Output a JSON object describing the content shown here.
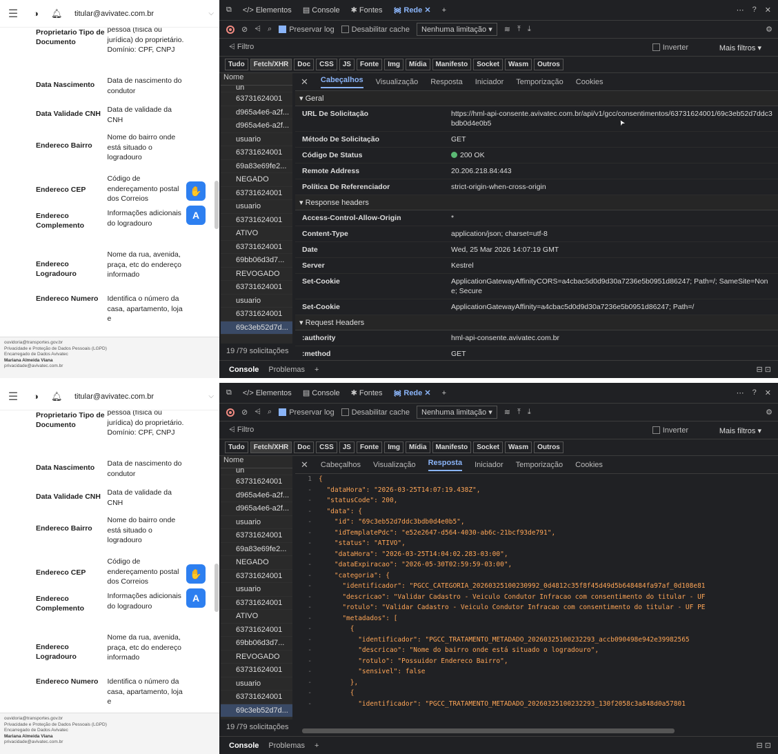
{
  "app": {
    "user_email": "titular@avivatec.com.br",
    "fab_label": "A"
  },
  "rows": [
    {
      "name": "Proprietario Tipo de Documento",
      "desc": "pessoa (física ou jurídica) do proprietário. Domínio: CPF, CNPJ"
    },
    {
      "name": "Data Nascimento",
      "desc": "Data de nascimento do condutor"
    },
    {
      "name": "Data Validade CNH",
      "desc": "Data de validade da CNH"
    },
    {
      "name": "Endereco Bairro",
      "desc": "Nome do bairro onde está situado o logradouro"
    },
    {
      "name": "Endereco CEP",
      "desc": "Código de endereçamento postal dos Correios"
    },
    {
      "name": "Endereco Complemento",
      "desc": "Informações adicionais do logradouro"
    },
    {
      "name": "Endereco Logradouro",
      "desc": "Nome da rua, avenida, praça, etc do endereço informado"
    },
    {
      "name": "Endereco Numero",
      "desc": "Identifica o número da casa, apartamento, loja e"
    }
  ],
  "footer": {
    "line1": "ouvidoria@transportes.gov.br",
    "line2": "Privacidade e Proteção de Dados Pessoais (LGPD)",
    "line3": "Encarregado de Dados Avivatec",
    "line4": "Mariana Almeida Viana",
    "line5": "privacidade@avivatec.com.br"
  },
  "devtools": {
    "tabs": [
      "Elementos",
      "Console",
      "Fontes",
      "Rede"
    ],
    "active_tab": "Rede",
    "preserve_log": "Preservar log",
    "disable_cache": "Desabilitar cache",
    "throttle": "Nenhuma limitação",
    "filter_placeholder": "Filtro",
    "invert": "Inverter",
    "more_filters": "Mais filtros",
    "chips": [
      "Tudo",
      "Fetch/XHR",
      "Doc",
      "CSS",
      "JS",
      "Fonte",
      "Img",
      "Mídia",
      "Manifesto",
      "Socket",
      "Wasm",
      "Outros"
    ],
    "chip_active": "Fetch/XHR",
    "name_header": "Nome",
    "names": [
      "un",
      "63731624001",
      "d965a4e6-a2f...",
      "d965a4e6-a2f...",
      "usuario",
      "63731624001",
      "69a83e69fe2...",
      "NEGADO",
      "63731624001",
      "usuario",
      "63731624001",
      "ATIVO",
      "63731624001",
      "69bb06d3d7...",
      "REVOGADO",
      "63731624001",
      "usuario",
      "63731624001",
      "69c3eb52d7d..."
    ],
    "count": "19 /79 solicitações",
    "panel_tabs": [
      "Cabeçalhos",
      "Visualização",
      "Resposta",
      "Iniciador",
      "Temporização",
      "Cookies"
    ],
    "drawer": [
      "Console",
      "Problemas"
    ],
    "json_toggle": "{ }"
  },
  "headers": {
    "general_title": "Geral",
    "general": [
      {
        "k": "URL De Solicitação",
        "v": "https://hml-api-consente.avivatec.com.br/api/v1/gcc/consentimentos/63731624001/69c3eb52d7ddc3bdb0d4e0b5"
      },
      {
        "k": "Método De Solicitação",
        "v": "GET"
      },
      {
        "k": "Código De Status",
        "v": "200 OK"
      },
      {
        "k": "Remote Address",
        "v": "20.206.218.84:443"
      },
      {
        "k": "Política De Referenciador",
        "v": "strict-origin-when-cross-origin"
      }
    ],
    "response_title": "Response headers",
    "response": [
      {
        "k": "Access-Control-Allow-Origin",
        "v": "*"
      },
      {
        "k": "Content-Type",
        "v": "application/json; charset=utf-8"
      },
      {
        "k": "Date",
        "v": "Wed, 25 Mar 2026 14:07:19 GMT"
      },
      {
        "k": "Server",
        "v": "Kestrel"
      },
      {
        "k": "Set-Cookie",
        "v": "ApplicationGatewayAffinityCORS=a4cbac5d0d9d30a7236e5b0951d86247; Path=/; SameSite=None; Secure"
      },
      {
        "k": "Set-Cookie",
        "v": "ApplicationGatewayAffinity=a4cbac5d0d9d30a7236e5b0951d86247; Path=/"
      }
    ],
    "request_title": "Request Headers",
    "request": [
      {
        "k": ":authority",
        "v": "hml-api-consente.avivatec.com.br"
      },
      {
        "k": ":method",
        "v": "GET"
      }
    ]
  },
  "response_lines": [
    "{",
    "  \"dataHora\": \"2026-03-25T14:07:19.438Z\",",
    "  \"statusCode\": 200,",
    "  \"data\": {",
    "    \"id\": \"69c3eb52d7ddc3bdb0d4e0b5\",",
    "    \"idTemplatePdc\": \"e52e2647-d564-4030-ab6c-21bcf93de791\",",
    "    \"status\": \"ATIVO\",",
    "    \"dataHora\": \"2026-03-25T14:04:02.283-03:00\",",
    "    \"dataExpiracao\": \"2026-05-30T02:59:59-03:00\",",
    "    \"categoria\": {",
    "      \"identificador\": \"PGCC_CATEGORIA_20260325100230992_0d4812c35f8f45d49d5b648484fa97af_0d108e81",
    "      \"descricao\": \"Validar Cadastro - Veiculo Condutor Infracao com consentimento do titular - UF",
    "      \"rotulo\": \"Validar Cadastro - Veiculo Condutor Infracao com consentimento do titular - UF PE",
    "      \"metadados\": [",
    "        {",
    "          \"identificador\": \"PGCC_TRATAMENTO_METADADO_20260325100232293_accb090498e942e39982565",
    "          \"descricao\": \"Nome do bairro onde está situado o logradouro\",",
    "          \"rotulo\": \"Possuidor Endereco Bairro\",",
    "          \"sensivel\": false",
    "        },",
    "        {",
    "          \"identificador\": \"PGCC_TRATAMENTO_METADADO_20260325100232293_130f2058c3a848d0a57801"
  ],
  "cursor_icon": "mouse-pointer-icon"
}
